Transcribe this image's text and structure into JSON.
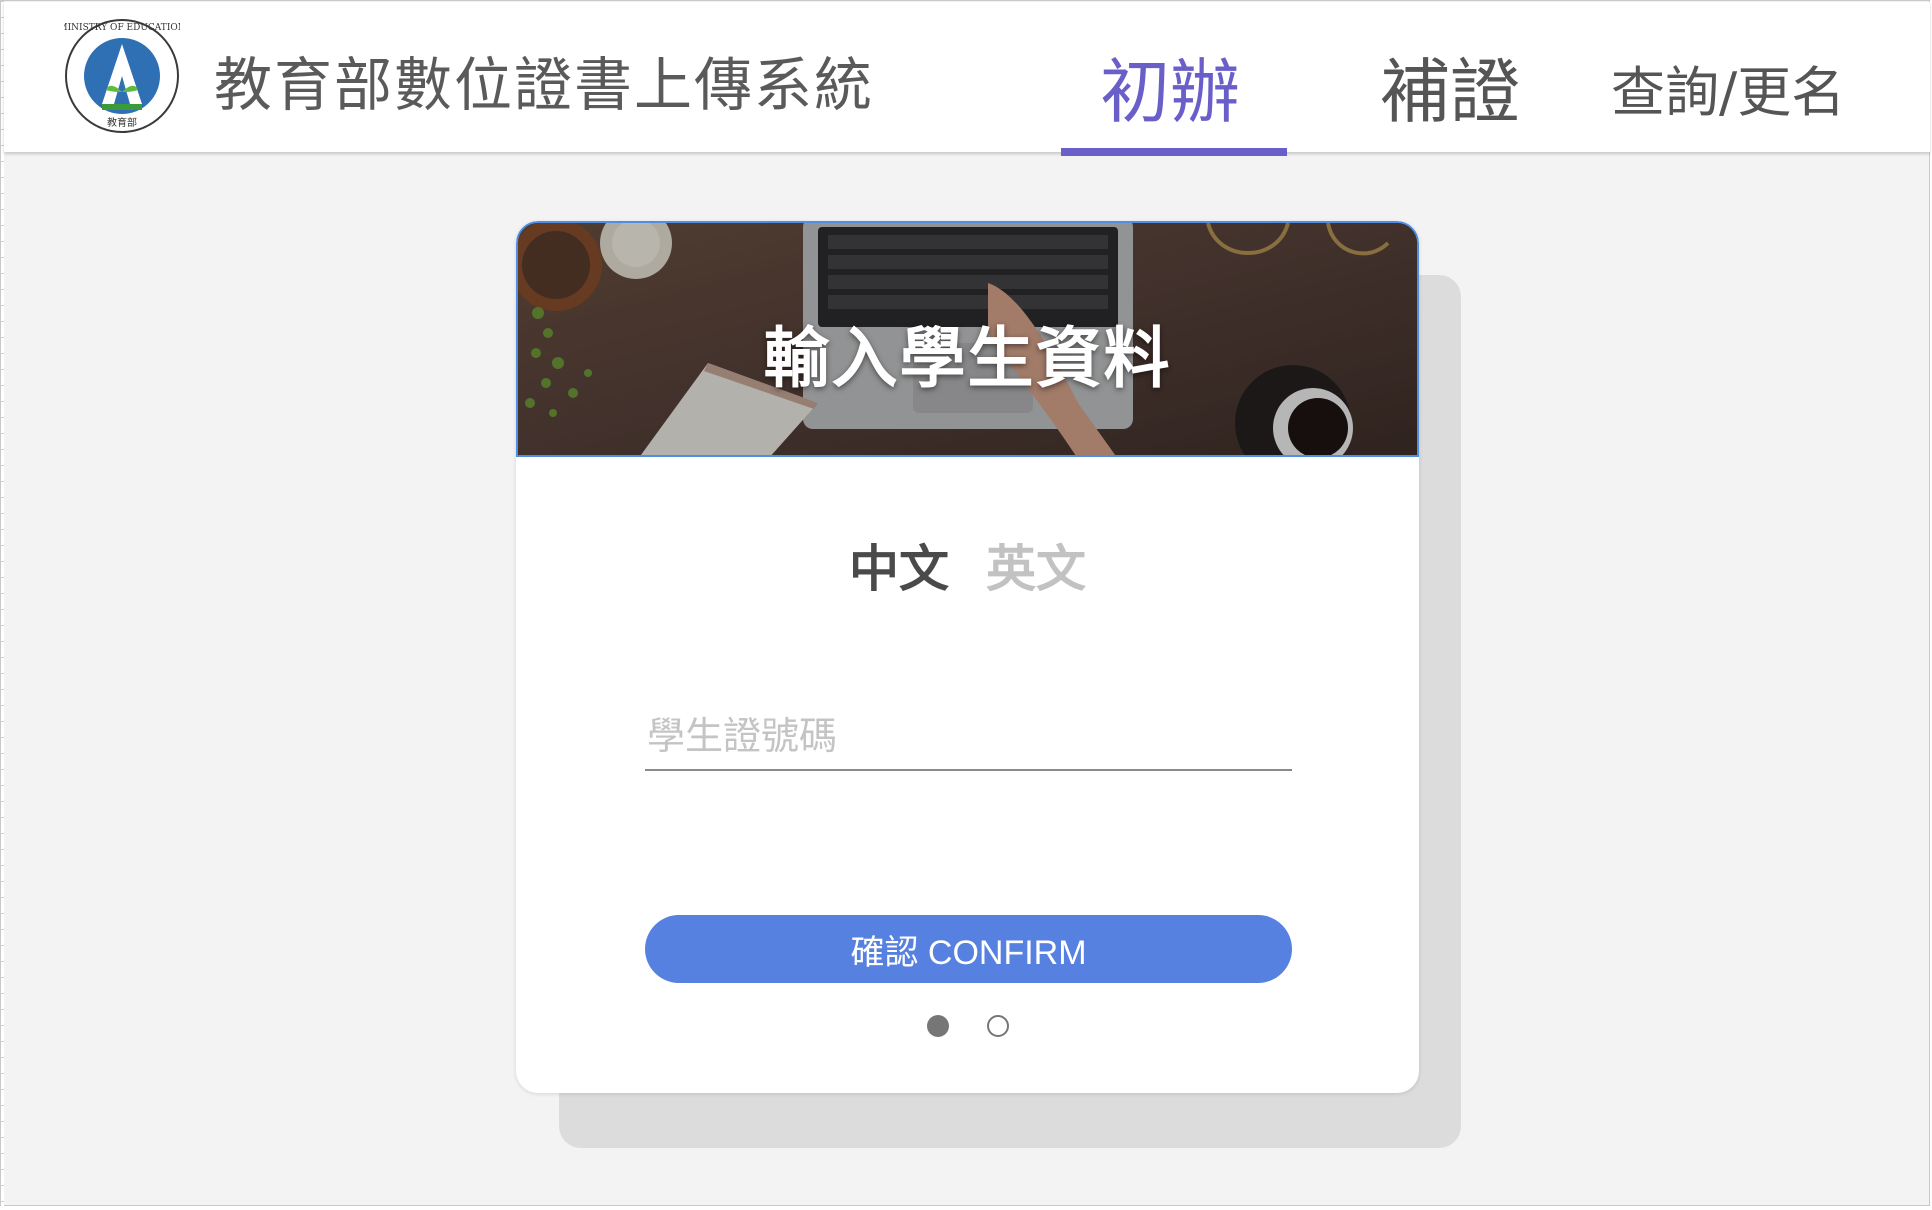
{
  "header": {
    "logo_text": "MINISTRY OF EDUCATION 教育部",
    "site_title": "教育部數位證書上傳系統",
    "nav": [
      {
        "label": "初辦",
        "active": true
      },
      {
        "label": "補證",
        "active": false
      },
      {
        "label": "查詢/更名",
        "active": false
      }
    ]
  },
  "card": {
    "banner_title": "輸入學生資料",
    "lang_tabs": [
      {
        "label": "中文",
        "active": true
      },
      {
        "label": "英文",
        "active": false
      }
    ],
    "student_id_placeholder": "學生證號碼",
    "student_id_value": "",
    "confirm_label": "確認 CONFIRM",
    "pager": {
      "pages": 2,
      "current": 1
    }
  },
  "colors": {
    "accent": "#6a5fc9",
    "button": "#5781e0",
    "page_bg": "#f3f3f3"
  }
}
